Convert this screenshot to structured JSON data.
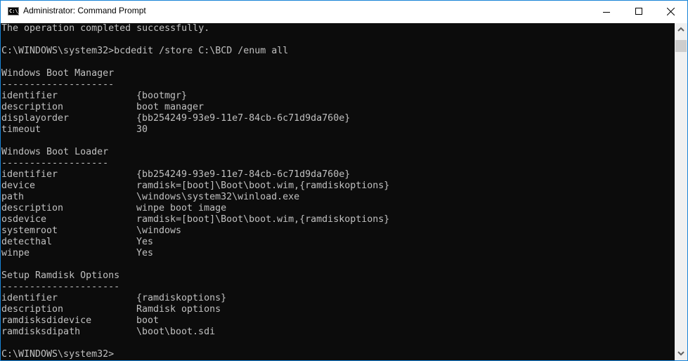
{
  "window": {
    "title": "Administrator: Command Prompt",
    "icon": "cmd-icon",
    "icon_text": "C:\\_",
    "controls": [
      "minimize",
      "maximize",
      "close"
    ]
  },
  "console": {
    "lines_top": [
      "The operation completed successfully.",
      "",
      "C:\\WINDOWS\\system32>bcdedit /store C:\\BCD /enum all",
      ""
    ],
    "sections": [
      {
        "heading": "Windows Boot Manager",
        "underline": "--------------------",
        "entries": [
          {
            "key": "identifier",
            "value": "{bootmgr}"
          },
          {
            "key": "description",
            "value": "boot manager"
          },
          {
            "key": "displayorder",
            "value": "{bb254249-93e9-11e7-84cb-6c71d9da760e}"
          },
          {
            "key": "timeout",
            "value": "30"
          }
        ]
      },
      {
        "heading": "Windows Boot Loader",
        "underline": "-------------------",
        "entries": [
          {
            "key": "identifier",
            "value": "{bb254249-93e9-11e7-84cb-6c71d9da760e}"
          },
          {
            "key": "device",
            "value": "ramdisk=[boot]\\Boot\\boot.wim,{ramdiskoptions}"
          },
          {
            "key": "path",
            "value": "\\windows\\system32\\winload.exe"
          },
          {
            "key": "description",
            "value": "winpe boot image"
          },
          {
            "key": "osdevice",
            "value": "ramdisk=[boot]\\Boot\\boot.wim,{ramdiskoptions}"
          },
          {
            "key": "systemroot",
            "value": "\\windows"
          },
          {
            "key": "detecthal",
            "value": "Yes"
          },
          {
            "key": "winpe",
            "value": "Yes"
          }
        ]
      },
      {
        "heading": "Setup Ramdisk Options",
        "underline": "---------------------",
        "entries": [
          {
            "key": "identifier",
            "value": "{ramdiskoptions}"
          },
          {
            "key": "description",
            "value": "Ramdisk options"
          },
          {
            "key": "ramdisksdidevice",
            "value": "boot"
          },
          {
            "key": "ramdisksdipath",
            "value": "\\boot\\boot.sdi"
          }
        ]
      }
    ],
    "prompt": "C:\\WINDOWS\\system32>"
  },
  "colors": {
    "console_bg": "#0c0c0c",
    "console_fg": "#c0c0c0",
    "window_border": "#1883d7",
    "scrollbar_bg": "#f0f0f0",
    "scrollbar_thumb": "#cdcdcd"
  }
}
